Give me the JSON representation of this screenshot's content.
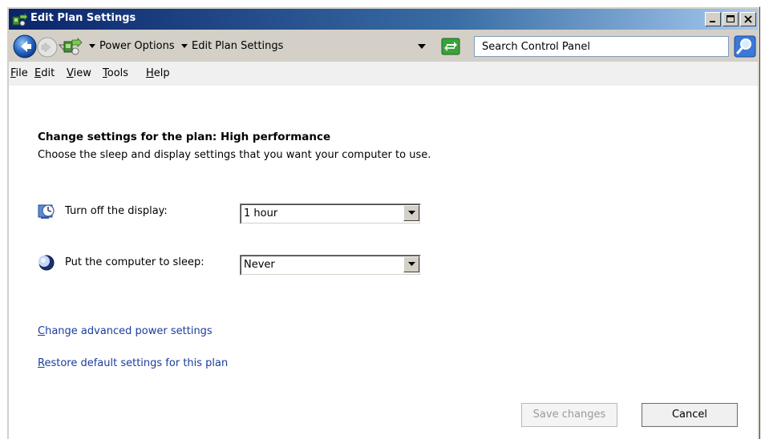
{
  "window": {
    "title": "Edit Plan Settings",
    "controls": {
      "minimize": "minimize",
      "maximize": "maximize",
      "close": "close"
    }
  },
  "address_bar": {
    "breadcrumbs": [
      "Power Options",
      "Edit Plan Settings"
    ],
    "search_placeholder": "Search Control Panel"
  },
  "menu": {
    "items": [
      {
        "label": "File",
        "mnemonic": "F",
        "rest": "ile"
      },
      {
        "label": "Edit",
        "mnemonic": "E",
        "rest": "dit"
      },
      {
        "label": "View",
        "mnemonic": "V",
        "rest": "iew"
      },
      {
        "label": "Tools",
        "mnemonic": "T",
        "rest": "ools"
      },
      {
        "label": "Help",
        "mnemonic": "H",
        "rest": "elp"
      }
    ]
  },
  "page": {
    "heading": "Change settings for the plan: High performance",
    "subtext": "Choose the sleep and display settings that you want your computer to use.",
    "settings": [
      {
        "label": "Turn off the display:",
        "icon": "display-timer-icon",
        "value": "1 hour"
      },
      {
        "label": "Put the computer to sleep:",
        "icon": "sleep-moon-icon",
        "value": "Never"
      }
    ],
    "links": [
      {
        "label": "Change advanced power settings",
        "mnemonic": "C",
        "rest": "hange advanced power settings"
      },
      {
        "label": "Restore default settings for this plan",
        "mnemonic": "R",
        "rest": "estore default settings for this plan"
      }
    ],
    "buttons": {
      "save": "Save changes",
      "cancel": "Cancel"
    }
  },
  "colors": {
    "title_gradient_start": "#0a246a",
    "title_gradient_end": "#a6caf0",
    "link": "#1a3c9c",
    "disabled_text": "#9a9a9a"
  }
}
